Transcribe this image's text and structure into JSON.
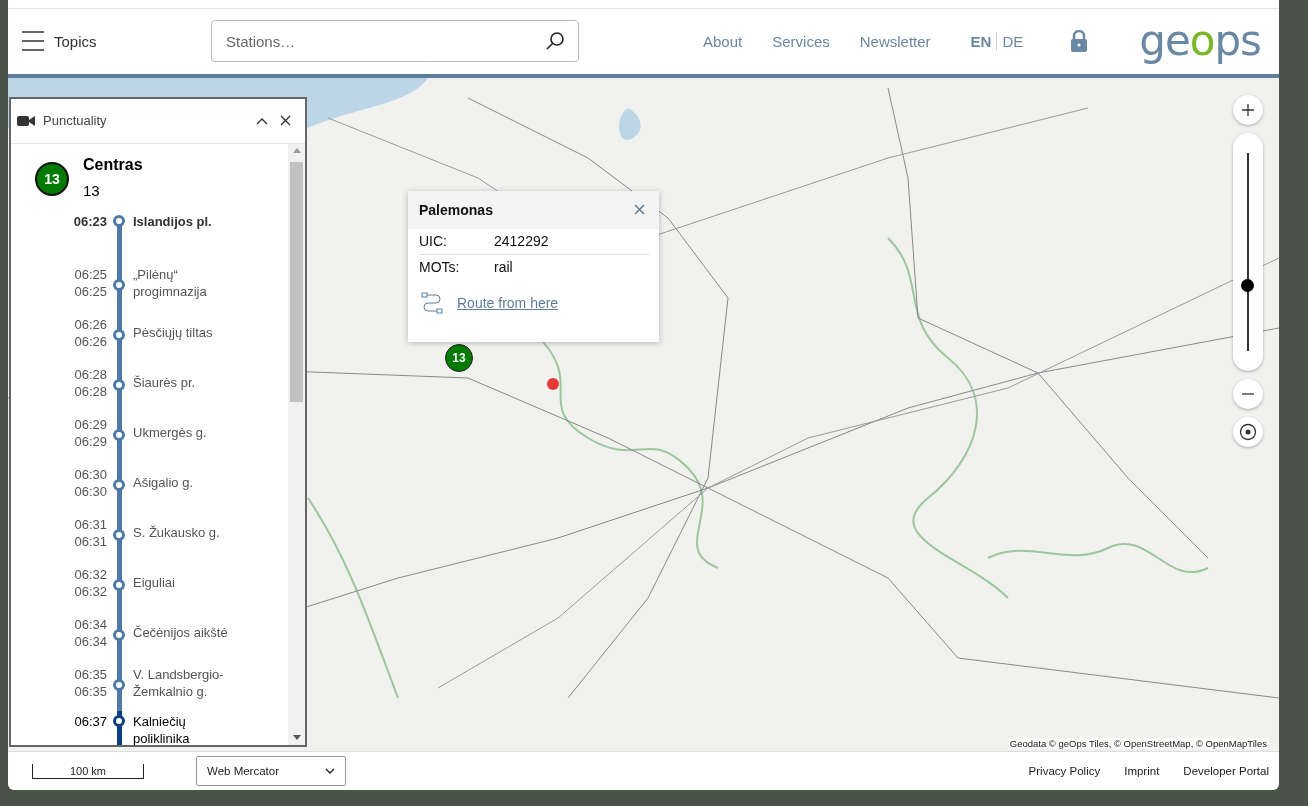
{
  "header": {
    "menu_label": "Topics",
    "search": {
      "placeholder": "Stations…"
    },
    "nav": [
      "About",
      "Services",
      "Newsletter"
    ],
    "languages": [
      {
        "label": "EN",
        "selected": true
      },
      {
        "label": "DE",
        "selected": false
      }
    ],
    "logo": "geops"
  },
  "panel": {
    "title": "Punctuality",
    "line": {
      "badge": "13",
      "color": "#007a00",
      "destination": "Centras",
      "number": "13"
    },
    "stops": [
      {
        "times": [
          "06:23"
        ],
        "name": "Islandijos pl.",
        "first": true,
        "current": false
      },
      {
        "times": [
          "06:25",
          "06:25"
        ],
        "name": "„Pilėnų“ progimnazija",
        "first": false,
        "current": false
      },
      {
        "times": [
          "06:26",
          "06:26"
        ],
        "name": "Pėsčiųjų tiltas",
        "first": false,
        "current": false
      },
      {
        "times": [
          "06:28",
          "06:28"
        ],
        "name": "Šiaurės pr.",
        "first": false,
        "current": false
      },
      {
        "times": [
          "06:29",
          "06:29"
        ],
        "name": "Ukmergės g.",
        "first": false,
        "current": false
      },
      {
        "times": [
          "06:30",
          "06:30"
        ],
        "name": "Ašigalio g.",
        "first": false,
        "current": false
      },
      {
        "times": [
          "06:31",
          "06:31"
        ],
        "name": "S. Žukausko g.",
        "first": false,
        "current": false
      },
      {
        "times": [
          "06:32",
          "06:32"
        ],
        "name": "Eiguliai",
        "first": false,
        "current": false
      },
      {
        "times": [
          "06:34",
          "06:34"
        ],
        "name": "Čečėnijos aikštė",
        "first": false,
        "current": false
      },
      {
        "times": [
          "06:35",
          "06:35"
        ],
        "name": "V. Landsbergio-Žemkalnio g.",
        "first": false,
        "current": false
      },
      {
        "times": [
          "06:37"
        ],
        "name": "Kalniečių poliklinika",
        "first": false,
        "current": true
      }
    ]
  },
  "map": {
    "kind": "picture",
    "vehicle_marker": {
      "label": "13",
      "color": "#007a00"
    },
    "popup": {
      "title": "Palemonas",
      "fields": [
        {
          "label": "UIC:",
          "value": "2412292"
        },
        {
          "label": "MOTs:",
          "value": "rail"
        }
      ],
      "link": "Route from here"
    },
    "zoom": {
      "level": 0.33
    },
    "attribution": "Geodata © geOps Tiles, © OpenStreetMap, © OpenMapTiles"
  },
  "footer": {
    "scale": "100 km",
    "projection": "Web Mercator",
    "links": [
      "Privacy Policy",
      "Imprint",
      "Developer Portal"
    ]
  }
}
